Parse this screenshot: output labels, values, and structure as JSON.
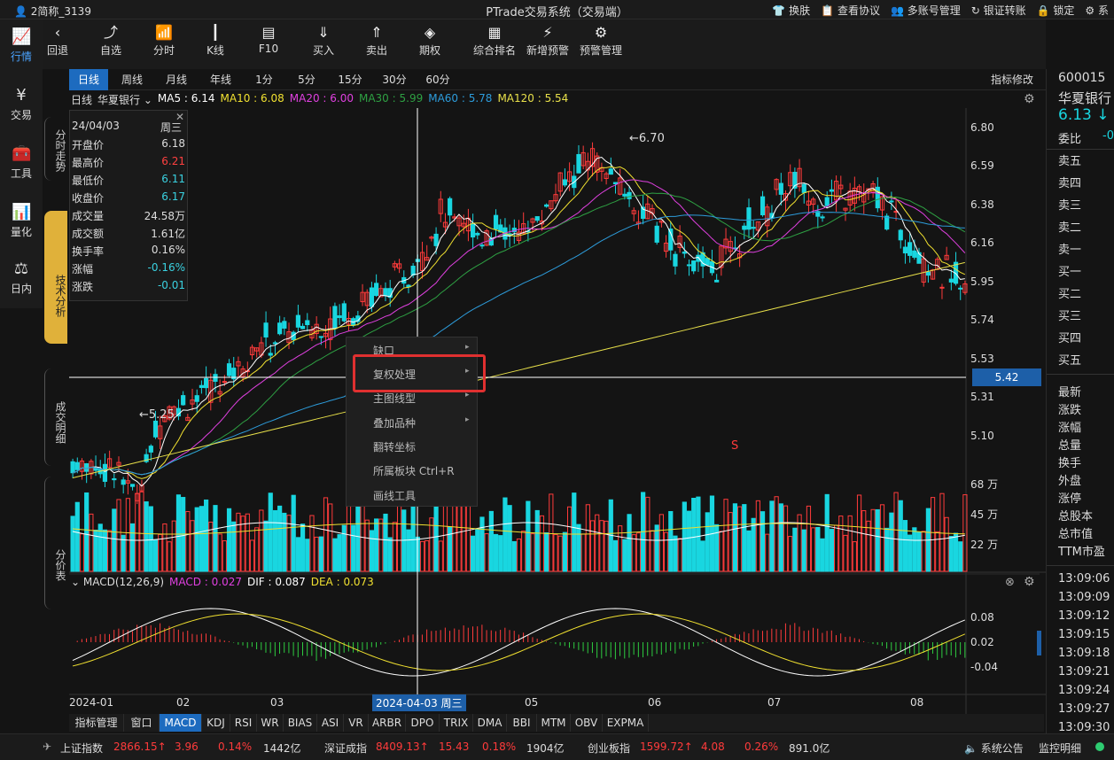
{
  "titlebar": {
    "account": "2简称_3139",
    "title": "PTrade交易系统（交易端）",
    "menu": [
      "换肤",
      "查看协议",
      "多账号管理",
      "银证转账",
      "锁定",
      "系"
    ]
  },
  "leftnav": [
    {
      "label": "行情",
      "icon": "chart-icon"
    },
    {
      "label": "交易",
      "icon": "yen-icon"
    },
    {
      "label": "工具",
      "icon": "toolbox-icon"
    },
    {
      "label": "量化",
      "icon": "quant-icon"
    },
    {
      "label": "日内",
      "icon": "scale-icon"
    }
  ],
  "toolbar": [
    {
      "label": "回退",
      "icon": "back-icon"
    },
    {
      "label": "自选",
      "icon": "watchlist-icon"
    },
    {
      "label": "分时",
      "icon": "timeshare-icon"
    },
    {
      "label": "K线",
      "icon": "candle-icon"
    },
    {
      "label": "F10",
      "icon": "f10-icon"
    },
    {
      "label": "买入",
      "icon": "buy-icon"
    },
    {
      "label": "卖出",
      "icon": "sell-icon"
    },
    {
      "label": "期权",
      "icon": "option-icon"
    },
    {
      "label": "综合排名",
      "icon": "ranking-icon"
    },
    {
      "label": "新增预警",
      "icon": "add-alert-icon"
    },
    {
      "label": "预警管理",
      "icon": "alert-manage-icon"
    }
  ],
  "sidetabs": [
    "分时走势",
    "技术分析",
    "成交明细",
    "分价表"
  ],
  "periods": [
    "日线",
    "周线",
    "月线",
    "年线",
    "1分",
    "5分",
    "15分",
    "30分",
    "60分"
  ],
  "indicator_edit": "指标修改",
  "ma": {
    "period": "日线",
    "stock": "华夏银行",
    "items": [
      {
        "label": "MA5 : 6.14",
        "color": "#ffffff"
      },
      {
        "label": "MA10 : 6.08",
        "color": "#f0e030"
      },
      {
        "label": "MA20 : 6.00",
        "color": "#e040e0"
      },
      {
        "label": "MA30 : 5.99",
        "color": "#2ea043"
      },
      {
        "label": "MA60 : 5.78",
        "color": "#2d9cdb"
      },
      {
        "label": "MA120 : 5.54",
        "color": "#e8e04a"
      }
    ]
  },
  "info": {
    "date": "24/04/03",
    "weekday": "周三",
    "rows": [
      {
        "k": "开盘价",
        "v": "6.18",
        "c": "#ddd"
      },
      {
        "k": "最高价",
        "v": "6.21",
        "c": "#ff4040"
      },
      {
        "k": "最低价",
        "v": "6.11",
        "c": "#3ad1e0"
      },
      {
        "k": "收盘价",
        "v": "6.17",
        "c": "#3ad1e0"
      },
      {
        "k": "成交量",
        "v": "24.58万",
        "c": "#ddd"
      },
      {
        "k": "成交额",
        "v": "1.61亿",
        "c": "#ddd"
      },
      {
        "k": "换手率",
        "v": "0.16%",
        "c": "#ddd"
      },
      {
        "k": "涨幅",
        "v": "-0.16%",
        "c": "#3ad1e0"
      },
      {
        "k": "涨跌",
        "v": "-0.01",
        "c": "#3ad1e0"
      }
    ]
  },
  "annotations": {
    "high": "←6.70",
    "low": "←5.25",
    "signal": "S"
  },
  "crosshair_price": "5.42",
  "price_axis": [
    "6.80",
    "6.59",
    "6.38",
    "6.16",
    "5.95",
    "5.74",
    "5.53",
    "5.31",
    "5.10"
  ],
  "volume_axis": [
    "68 万",
    "45 万",
    "22 万"
  ],
  "macd": {
    "title": "MACD(12,26,9)",
    "macd": "MACD : 0.027",
    "dif": "DIF : 0.087",
    "dea": "DEA : 0.073",
    "axis": [
      "0.08",
      "0.02",
      "-0.04"
    ]
  },
  "date_axis": [
    "2024-01",
    "02",
    "03",
    "04",
    "05",
    "06",
    "07",
    "08"
  ],
  "crosshair_date": "2024-04-03 周三",
  "context_menu": [
    "缺口",
    "复权处理",
    "主图线型",
    "叠加品种",
    "翻转坐标",
    "所属板块 Ctrl+R",
    "画线工具"
  ],
  "indicator_tabs": [
    "指标管理",
    "窗口",
    "MACD",
    "KDJ",
    "RSI",
    "WR",
    "BIAS",
    "ASI",
    "VR",
    "ARBR",
    "DPO",
    "TRIX",
    "DMA",
    "BBI",
    "MTM",
    "OBV",
    "EXPMA"
  ],
  "statusbar": {
    "indices": [
      {
        "name": "上证指数",
        "price": "2866.15",
        "chg": "3.96",
        "pct": "0.14%",
        "amt": "1442亿"
      },
      {
        "name": "深证成指",
        "price": "8409.13",
        "chg": "15.43",
        "pct": "0.18%",
        "amt": "1904亿"
      },
      {
        "name": "创业板指",
        "price": "1599.72",
        "chg": "4.08",
        "pct": "0.26%",
        "amt": "891.0亿"
      }
    ],
    "notice": "系统公告",
    "monitor": "监控明细"
  },
  "rightpanel": {
    "code": "600015",
    "name": "华夏银行",
    "price": "6.13",
    "weibi": "委比",
    "weibi_val": "-0",
    "orderbook": [
      "卖五",
      "卖四",
      "卖三",
      "卖二",
      "卖一",
      "买一",
      "买二",
      "买三",
      "买四",
      "买五"
    ],
    "stats": [
      "最新",
      "涨跌",
      "涨幅",
      "总量",
      "换手",
      "外盘",
      "涨停",
      "总股本",
      "总市值",
      "TTM市盈"
    ],
    "times": [
      "13:09:06",
      "13:09:09",
      "13:09:12",
      "13:09:15",
      "13:09:18",
      "13:09:21",
      "13:09:24",
      "13:09:27",
      "13:09:30"
    ]
  },
  "colors": {
    "up": "#ff3b3b",
    "down": "#19d6e0",
    "accent": "#1d6bbf",
    "tab_active": "#e0b13a"
  }
}
